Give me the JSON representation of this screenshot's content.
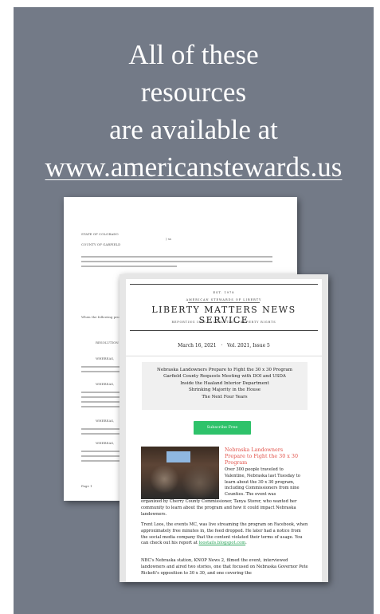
{
  "headline": {
    "line1": "All of these",
    "line2": "resources",
    "line3": "are available at",
    "url": "www.americanstewards.us"
  },
  "back_document": {
    "state": "STATE OF COLORADO",
    "county": "COUNTY OF GARFIELD",
    "ss": ") ss",
    "intro": "At a regular meeting of the Board of County Commissioners for Garfield County, Colorado, held at the County Administration Building in Glenwood Springs on Tuesday, the 16th day of February, there were present:",
    "when": "When the following proceedings, among others were had and done, to-wit:",
    "resolution": "RESOLUTION",
    "whereas1": "WHEREAS,",
    "whereas2": "WHEREAS,",
    "whereas3": "WHEREAS,",
    "whereas4": "WHEREAS,",
    "footer": "Page 1"
  },
  "newsletter": {
    "est": "EST. 1978",
    "org": "AMERICAN STEWARDS OF LIBERTY",
    "title": "LIBERTY MATTERS NEWS SERVICE",
    "tagline": "REPORTING ISSUES IMPACTING PROPERTY RIGHTS",
    "date": "March 16, 2021",
    "separator": "·",
    "volume": "Vol. 2021, Issue 5",
    "toc": [
      "Nebraska Landowners Prepare to Fight the 30 x 30 Program",
      "Garfield County Requests Meeting with DOI and USDA",
      "Inside the Haaland Interior Department",
      "Shrinking Majority in the House",
      "The Next Four Years"
    ],
    "subscribe_label": "Subscribe Free",
    "article": {
      "title": "Nebraska Landowners Prepare to Fight the 30 x 30 Program",
      "para1_wrap": "Over 300 people traveled to Valentine, Nebraska last Tuesday to learn about the 30 x 30 program, including Commissioners from nine Counties. The event was",
      "para1_rest": "organized by Cherry County Commissioner, Tanya Storer, who wanted her community to learn about the program and how it could impact Nebraska landowners.",
      "para2": "Trent Loos, the events MC, was live streaming the program on Facebook, when approximately free minutes in, the feed dropped. He later had a notice from the social media company that the content violated their terms of usage. You can check out his report at",
      "para2_link": "loostails.blogspot.com",
      "para2_end": ".",
      "para3": "NBC's Nebraska station, KNOP News 2, filmed the event, interviewed landowners and aired two stories, one that focused on Nebraska Governor Pete Rickett's opposition to 30 x 30, and one covering the"
    }
  },
  "colors": {
    "panel": "#737a87",
    "accent_title": "#e2534b",
    "subscribe": "#2ec26a",
    "link": "#2aa55a"
  }
}
